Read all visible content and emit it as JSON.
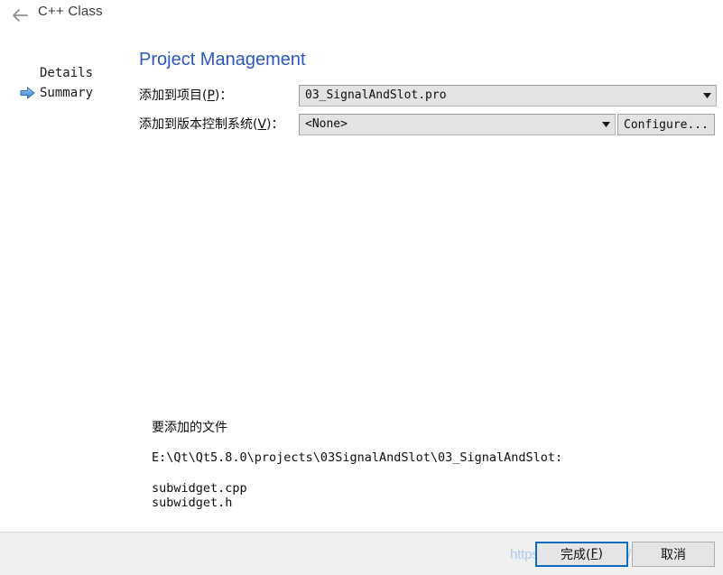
{
  "header": {
    "back_icon": "back-arrow-icon",
    "title": "C++ Class"
  },
  "steps": {
    "current_marker_icon": "right-arrow-icon",
    "items": [
      {
        "label": "Details",
        "current": false
      },
      {
        "label": "Summary",
        "current": true
      }
    ]
  },
  "page": {
    "title": "Project Management",
    "title_color": "#2a56c6"
  },
  "form": {
    "project_row": {
      "label_prefix": "添加到项目(",
      "label_mnemonic": "P",
      "label_suffix": ")：",
      "value": "03_SignalAndSlot.pro",
      "dropdown_icon": "chevron-down-icon"
    },
    "vcs_row": {
      "label_prefix": "添加到版本控制系统(",
      "label_mnemonic": "V",
      "label_suffix": ")：",
      "value": "<None>",
      "dropdown_icon": "chevron-down-icon",
      "configure_label": "Configure..."
    }
  },
  "files_summary": {
    "heading": "要添加的文件",
    "path": "E:\\Qt\\Qt5.8.0\\projects\\03SignalAndSlot\\03_SignalAndSlot:",
    "files": [
      "subwidget.cpp",
      "subwidget.h"
    ]
  },
  "footer": {
    "finish_prefix": "完成(",
    "finish_mnemonic": "F",
    "finish_suffix": ")",
    "cancel_label": "取消",
    "accent_color": "#0b6cc1"
  },
  "watermark": {
    "text": "https://blog.csdn.net/xuechanba"
  }
}
